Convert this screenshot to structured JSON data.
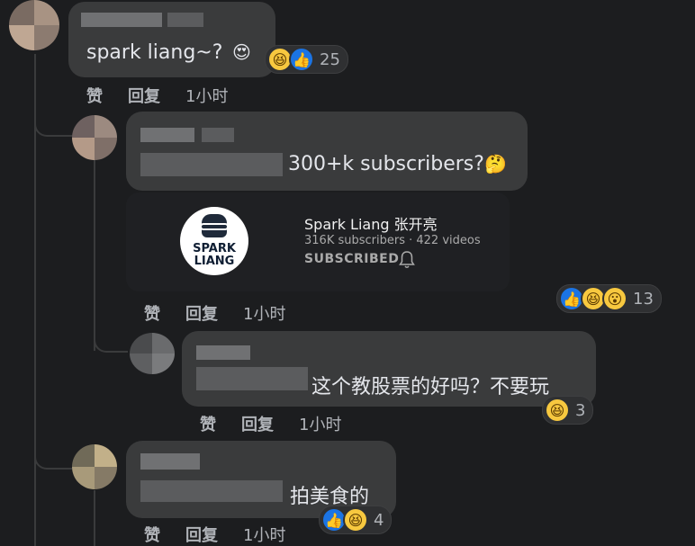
{
  "comments": [
    {
      "text": "spark liang~?",
      "text_emoji": "😍",
      "actions": {
        "like": "赞",
        "reply": "回复",
        "time": "1小时"
      },
      "reactions": {
        "icons": [
          "haha-icon",
          "like-icon"
        ],
        "glyphs": [
          "😆",
          "👍"
        ],
        "count": "25"
      }
    },
    {
      "text": "300+k subscribers?",
      "text_emoji": "🤔",
      "channel": {
        "name": "Spark Liang 张开亮",
        "meta": "316K subscribers · 422 videos",
        "status": "SUBSCRIBED",
        "logo_text_1": "SPARK",
        "logo_text_2": "LIANG"
      },
      "actions": {
        "like": "赞",
        "reply": "回复",
        "time": "1小时"
      },
      "reactions": {
        "glyphs": [
          "👍",
          "😆",
          "😮"
        ],
        "count": "13"
      }
    },
    {
      "text": "这个教股票的好吗？不要玩",
      "actions": {
        "like": "赞",
        "reply": "回复",
        "time": "1小时"
      },
      "reactions": {
        "glyphs": [
          "😆"
        ],
        "count": "3"
      }
    },
    {
      "text": "拍美食的",
      "actions": {
        "like": "赞",
        "reply": "回复",
        "time": "1小时"
      },
      "reactions": {
        "glyphs": [
          "👍",
          "😆"
        ],
        "count": "4"
      }
    }
  ],
  "colors": {
    "background": "#1c1d1f",
    "bubble": "#3a3b3c",
    "like_blue": "#1b74e4",
    "haha_yellow": "#f7c83f"
  }
}
